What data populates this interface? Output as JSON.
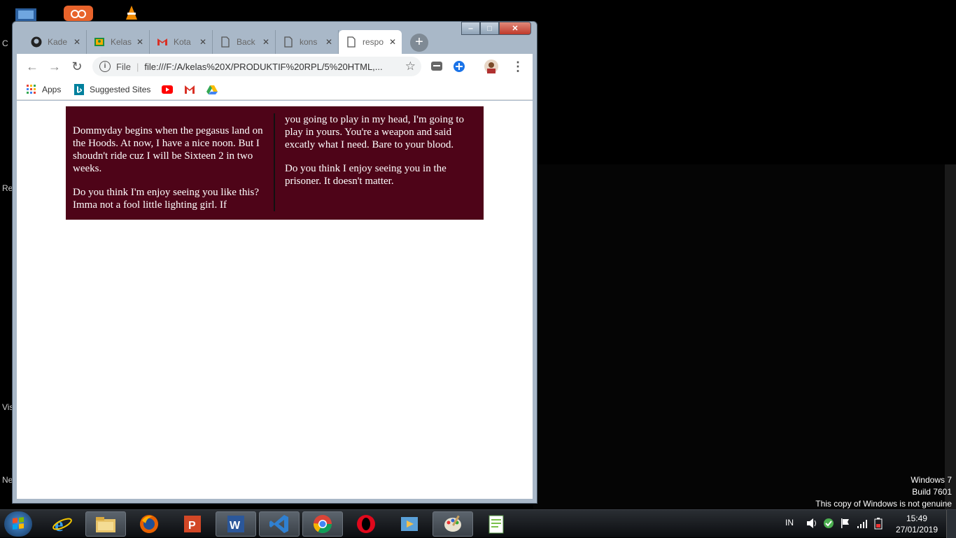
{
  "desktop": {
    "labels": [
      "C",
      "Re",
      "Vis",
      "Ne"
    ],
    "watermark": {
      "line1": "Windows 7",
      "line2": "Build 7601",
      "line3": "This copy of Windows is not genuine"
    }
  },
  "browser": {
    "tabs": [
      {
        "title": "Kade",
        "icon": "github-icon"
      },
      {
        "title": "Kelas",
        "icon": "classroom-icon"
      },
      {
        "title": "Kota",
        "icon": "gmail-icon"
      },
      {
        "title": "Back",
        "icon": "document-icon"
      },
      {
        "title": "kons",
        "icon": "document-icon"
      },
      {
        "title": "respo",
        "icon": "document-icon",
        "active": true
      }
    ],
    "new_tab_label": "+",
    "window_controls": {
      "minimize": "‒",
      "maximize": "□",
      "close": "✕"
    },
    "address": {
      "scheme_label": "File",
      "url": "file:///F:/A/kelas%20X/PRODUKTIF%20RPL/5%20HTML,..."
    },
    "bookmarks": {
      "apps_label": "Apps",
      "suggested_label": "Suggested Sites"
    }
  },
  "article": {
    "left_p1": "Dommyday begins when the pegasus land on the Hoods. At now, I have a nice noon. But I shoudn't ride cuz I will be Sixteen 2 in two weeks.",
    "left_p2": "Do you think I'm enjoy seeing you like this? Imma not a fool little lighting girl. If",
    "right_p1": "you going to play in my head, I'm going to play in yours. You're a weapon and said excatly what I need. Bare to your blood.",
    "right_p2": "Do you think I enjoy seeing you in the prisoner. It doesn't matter.",
    "background_color": "#4e0418"
  },
  "taskbar": {
    "apps": [
      "internet-explorer",
      "file-explorer",
      "firefox",
      "powerpoint",
      "word",
      "visual-studio-code",
      "chrome",
      "opera",
      "media-player",
      "paint",
      "notepad-plus"
    ],
    "language": "IN",
    "time": "15:49",
    "date": "27/01/2019"
  }
}
